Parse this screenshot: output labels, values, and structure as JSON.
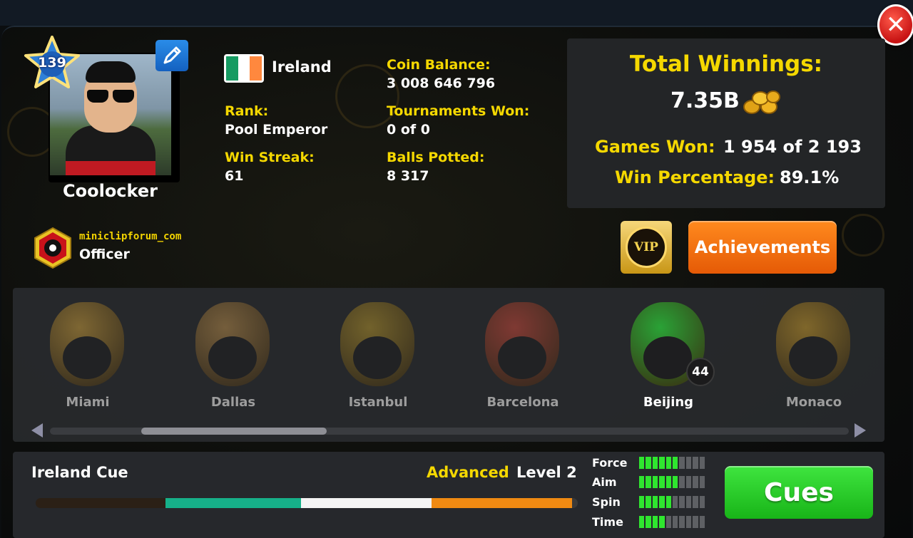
{
  "profile": {
    "level": "139",
    "username": "Coolocker",
    "club": {
      "name": "miniclipforum_com",
      "role": "Officer"
    },
    "country": "Ireland",
    "flag_colors": [
      "#169b62",
      "#ffffff",
      "#ff883e"
    ]
  },
  "stats": {
    "rank_label": "Rank:",
    "rank_value": "Pool Emperor",
    "streak_label": "Win Streak:",
    "streak_value": "61",
    "coin_label": "Coin Balance:",
    "coin_value": "3 008 646 796",
    "tournaments_label": "Tournaments Won:",
    "tournaments_value": "0 of 0",
    "balls_label": "Balls Potted:",
    "balls_value": "8 317"
  },
  "winnings": {
    "title": "Total Winnings:",
    "value": "7.35B",
    "games_won_label": "Games Won:",
    "games_won_value": "1 954 of 2 193",
    "win_pct_label": "Win Percentage:",
    "win_pct_value": "89.1%"
  },
  "buttons": {
    "vip": "VIP",
    "achievements": "Achievements",
    "cues": "Cues",
    "close": "✕"
  },
  "rings": [
    {
      "name": "Miami",
      "color": "#c69a3a"
    },
    {
      "name": "Dallas",
      "color": "#b58a4a"
    },
    {
      "name": "Istanbul",
      "color": "#b0912c"
    },
    {
      "name": "Barcelona",
      "color": "#c8483a"
    },
    {
      "name": "Beijing",
      "color": "#2aa236",
      "count": "44",
      "active": true
    },
    {
      "name": "Monaco",
      "color": "#c89a2c"
    }
  ],
  "cue": {
    "name": "Ireland Cue",
    "tier": "Advanced",
    "level": "Level 2",
    "colors": [
      "#2b2016",
      "#16b089",
      "#f4f4f4",
      "#f08a12",
      "#3a3a3a"
    ],
    "attributes": [
      {
        "label": "Force",
        "filled": 6,
        "total": 10
      },
      {
        "label": "Aim",
        "filled": 6,
        "total": 10
      },
      {
        "label": "Spin",
        "filled": 5,
        "total": 10
      },
      {
        "label": "Time",
        "filled": 4,
        "total": 10
      }
    ]
  },
  "accent_colors": {
    "label_yellow": "#f5d800",
    "achievements_orange": "#f07a12",
    "cues_green": "#2bd12b",
    "close_red": "#d81e1e"
  }
}
